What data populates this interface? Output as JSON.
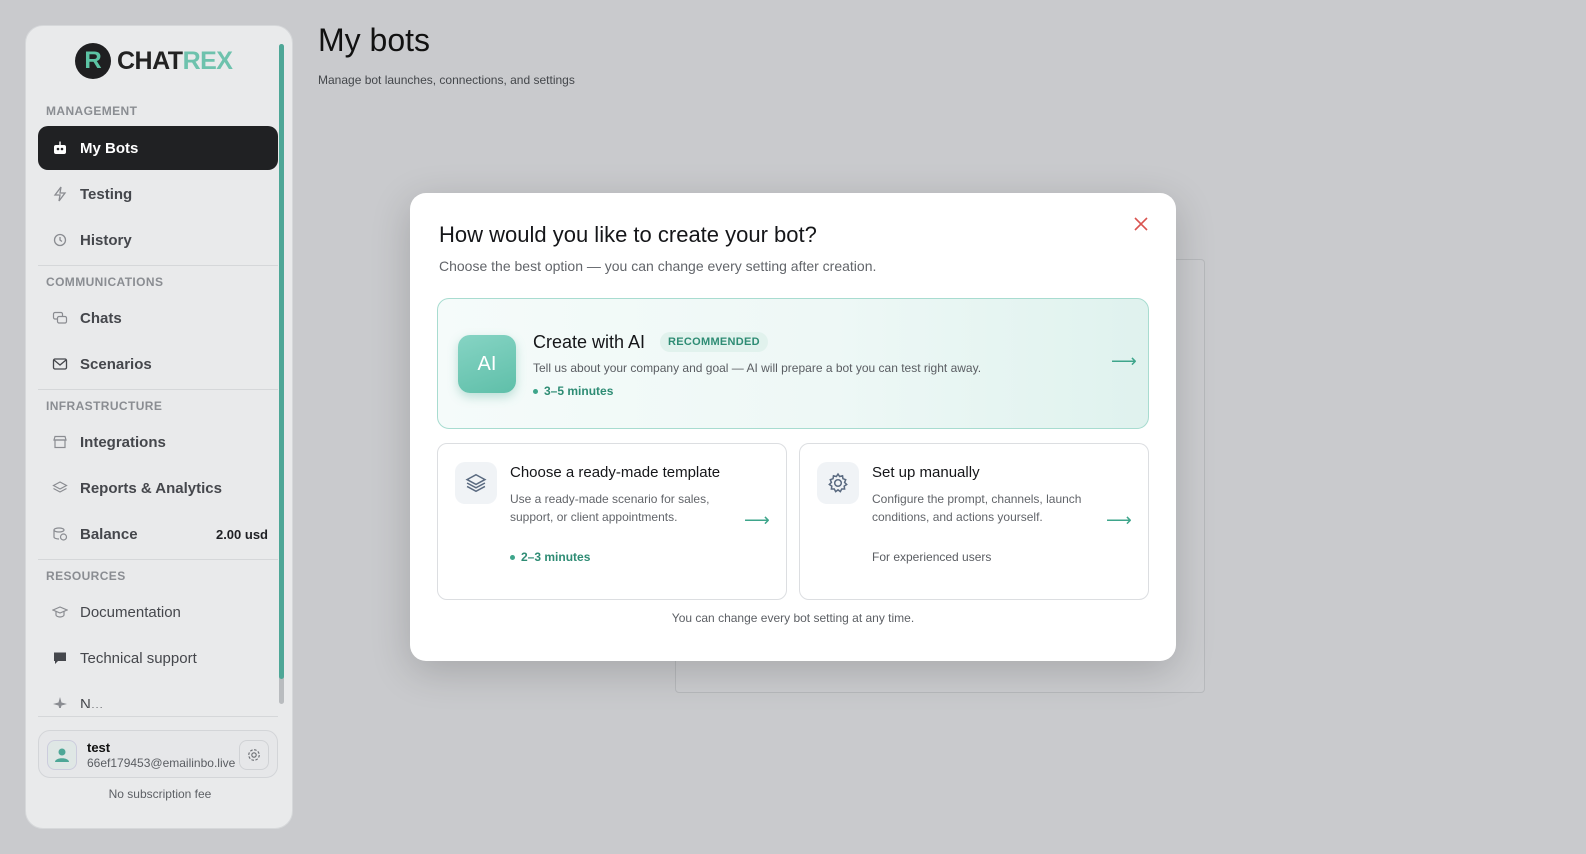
{
  "brand": {
    "mark": "R",
    "name_part1": "CHAT",
    "name_part2": "REX"
  },
  "sidebar": {
    "sections": {
      "management": "MANAGEMENT",
      "communications": "COMMUNICATIONS",
      "infrastructure": "INFRASTRUCTURE",
      "resources": "RESOURCES"
    },
    "items": {
      "my_bots": "My Bots",
      "testing": "Testing",
      "history": "History",
      "chats": "Chats",
      "scenarios": "Scenarios",
      "integrations": "Integrations",
      "reports": "Reports & Analytics",
      "balance": "Balance",
      "balance_value": "2.00 usd",
      "documentation": "Documentation",
      "support": "Technical support",
      "partial": "N..."
    },
    "user": {
      "name": "test",
      "email": "66ef179453@emailinbo.live"
    },
    "subscription_note": "No subscription fee"
  },
  "page": {
    "title": "My bots",
    "subtitle": "Manage bot launches, connections, and settings"
  },
  "modal": {
    "title": "How would you like to create your bot?",
    "subtitle": "Choose the best option — you can change every setting after creation.",
    "ai_option": {
      "badge": "AI",
      "title": "Create with AI",
      "tag": "RECOMMENDED",
      "description": "Tell us about your company and goal — AI will prepare a bot you can test right away.",
      "time": "3–5 minutes"
    },
    "template_option": {
      "title": "Choose a ready-made template",
      "description": "Use a ready-made scenario for sales, support, or client appointments.",
      "time": "2–3 minutes"
    },
    "manual_option": {
      "title": "Set up manually",
      "description": "Configure the prompt, channels, launch conditions, and actions yourself.",
      "note": "For experienced users"
    },
    "footer": "You can change every bot setting at any time."
  },
  "colors": {
    "accent": "#3ea58b",
    "close": "#d9534f",
    "active_nav": "#202123"
  }
}
